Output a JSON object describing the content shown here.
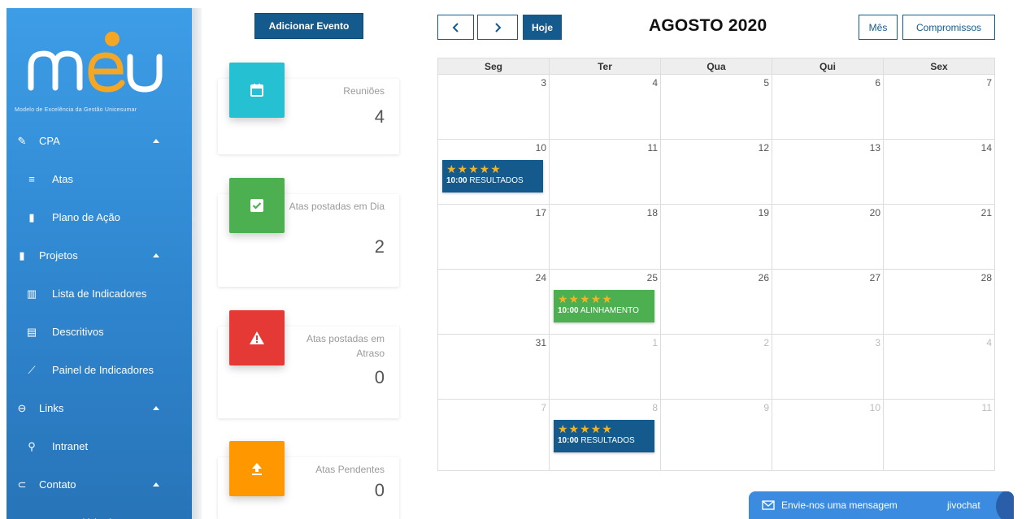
{
  "sidebar": {
    "logo_text": "meu",
    "logo_subtitle": "Modelo de Excelência da Gestão Unicesumar",
    "items": [
      {
        "type": "section",
        "icon": "pencil-icon",
        "label": "CPA",
        "expanded": true
      },
      {
        "type": "sub",
        "icon": "list-check-icon",
        "label": "Atas"
      },
      {
        "type": "sub",
        "icon": "book-open-icon",
        "label": "Plano de Ação"
      },
      {
        "type": "section",
        "icon": "book-icon",
        "label": "Projetos",
        "expanded": true
      },
      {
        "type": "sub",
        "icon": "chart-icon",
        "label": "Lista de Indicadores"
      },
      {
        "type": "sub",
        "icon": "document-icon",
        "label": "Descritivos"
      },
      {
        "type": "sub",
        "icon": "trending-icon",
        "label": "Painel de Indicadores"
      },
      {
        "type": "section",
        "icon": "link-icon",
        "label": "Links",
        "expanded": true
      },
      {
        "type": "sub",
        "icon": "running-icon",
        "label": "Intranet"
      },
      {
        "type": "section",
        "icon": "hearing-icon",
        "label": "Contato",
        "expanded": true
      },
      {
        "type": "sub",
        "icon": "contact-card-icon",
        "label": "Formulário de Contato"
      }
    ]
  },
  "actions": {
    "add_event": "Adicionar Evento"
  },
  "cards": [
    {
      "icon": "calendar-icon",
      "color": "#26c0d3",
      "label": "Reuniões",
      "value": "4"
    },
    {
      "icon": "check-box-icon",
      "color": "#4caf50",
      "label": "Atas postadas em Dia",
      "value": "2"
    },
    {
      "icon": "warning-icon",
      "color": "#e53935",
      "label": "Atas postadas em Atraso",
      "value": "0"
    },
    {
      "icon": "upload-icon",
      "color": "#ff9800",
      "label": "Atas Pendentes",
      "value": "0"
    }
  ],
  "calendar": {
    "prev": "<",
    "next": ">",
    "today": "Hoje",
    "title": "AGOSTO 2020",
    "views": [
      "Mês",
      "Compromissos"
    ],
    "weekdays": [
      "Seg",
      "Ter",
      "Qua",
      "Qui",
      "Sex"
    ],
    "weeks": [
      [
        {
          "d": "3"
        },
        {
          "d": "4"
        },
        {
          "d": "5"
        },
        {
          "d": "6"
        },
        {
          "d": "7"
        }
      ],
      [
        {
          "d": "10"
        },
        {
          "d": "11"
        },
        {
          "d": "12"
        },
        {
          "d": "13"
        },
        {
          "d": "14"
        }
      ],
      [
        {
          "d": "17"
        },
        {
          "d": "18"
        },
        {
          "d": "19"
        },
        {
          "d": "20"
        },
        {
          "d": "21"
        }
      ],
      [
        {
          "d": "24"
        },
        {
          "d": "25"
        },
        {
          "d": "26"
        },
        {
          "d": "27"
        },
        {
          "d": "28"
        }
      ],
      [
        {
          "d": "31"
        },
        {
          "d": "1",
          "other": true
        },
        {
          "d": "2",
          "other": true
        },
        {
          "d": "3",
          "other": true
        },
        {
          "d": "4",
          "other": true
        }
      ],
      [
        {
          "d": "7",
          "other": true
        },
        {
          "d": "8",
          "other": true
        },
        {
          "d": "9",
          "other": true
        },
        {
          "d": "10",
          "other": true
        },
        {
          "d": "11",
          "other": true
        }
      ]
    ],
    "events": [
      {
        "week": 1,
        "day": 0,
        "stars": "★★★★★",
        "time": "10:00",
        "title": "RESULTADOS",
        "color": "#155a8c"
      },
      {
        "week": 3,
        "day": 1,
        "stars": "★★★★★",
        "time": "10:00",
        "title": "ALINHAMENTO",
        "color": "#4caf50"
      },
      {
        "week": 5,
        "day": 1,
        "stars": "★★★★★",
        "time": "10:00",
        "title": "RESULTADOS",
        "color": "#155a8c"
      }
    ]
  },
  "chat": {
    "label": "Envie-nos uma mensagem",
    "brand": "jivochat"
  }
}
